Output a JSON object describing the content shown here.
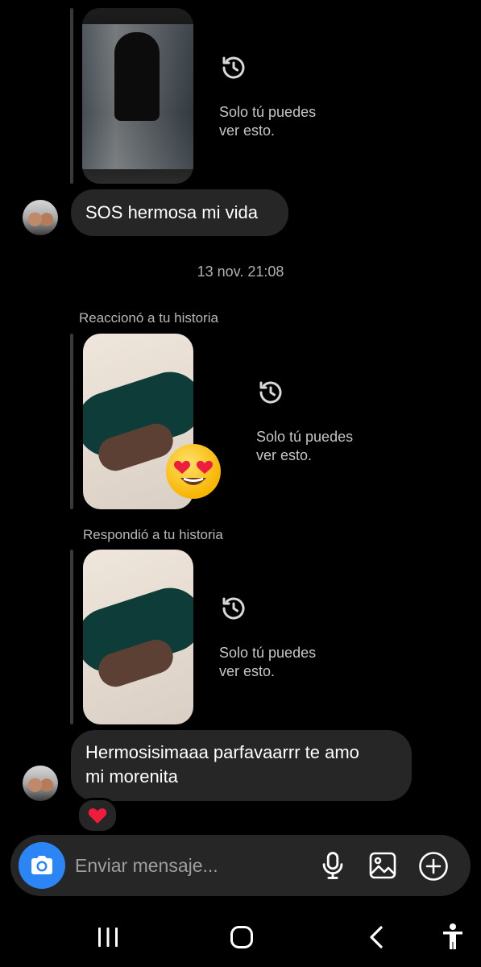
{
  "thread": {
    "timestamp": "13 nov. 21:08",
    "story_private_note": "Solo tú puedes ver esto.",
    "story_private_line1": "Solo tú puedes",
    "story_private_line2": "ver esto.",
    "reacted_label": "Reaccionó a tu historia",
    "replied_label": "Respondió a tu historia",
    "messages": [
      {
        "text": "SOS hermosa mi vida"
      },
      {
        "line1": "Hermosisimaaa parfavaarrr te amo",
        "line2": "mi morenita",
        "reaction": "heart"
      }
    ],
    "story_reaction_emoji": "heart-eyes"
  },
  "composer": {
    "placeholder": "Enviar mensaje..."
  },
  "colors": {
    "background": "#000000",
    "bubble": "#262626",
    "camera_button": "#2b85f5",
    "heart": "#ef1d3d"
  },
  "icons": [
    "history-icon",
    "camera-icon",
    "microphone-icon",
    "gallery-icon",
    "plus-circle-icon",
    "recents-nav-icon",
    "home-nav-icon",
    "back-nav-icon",
    "accessibility-icon"
  ]
}
